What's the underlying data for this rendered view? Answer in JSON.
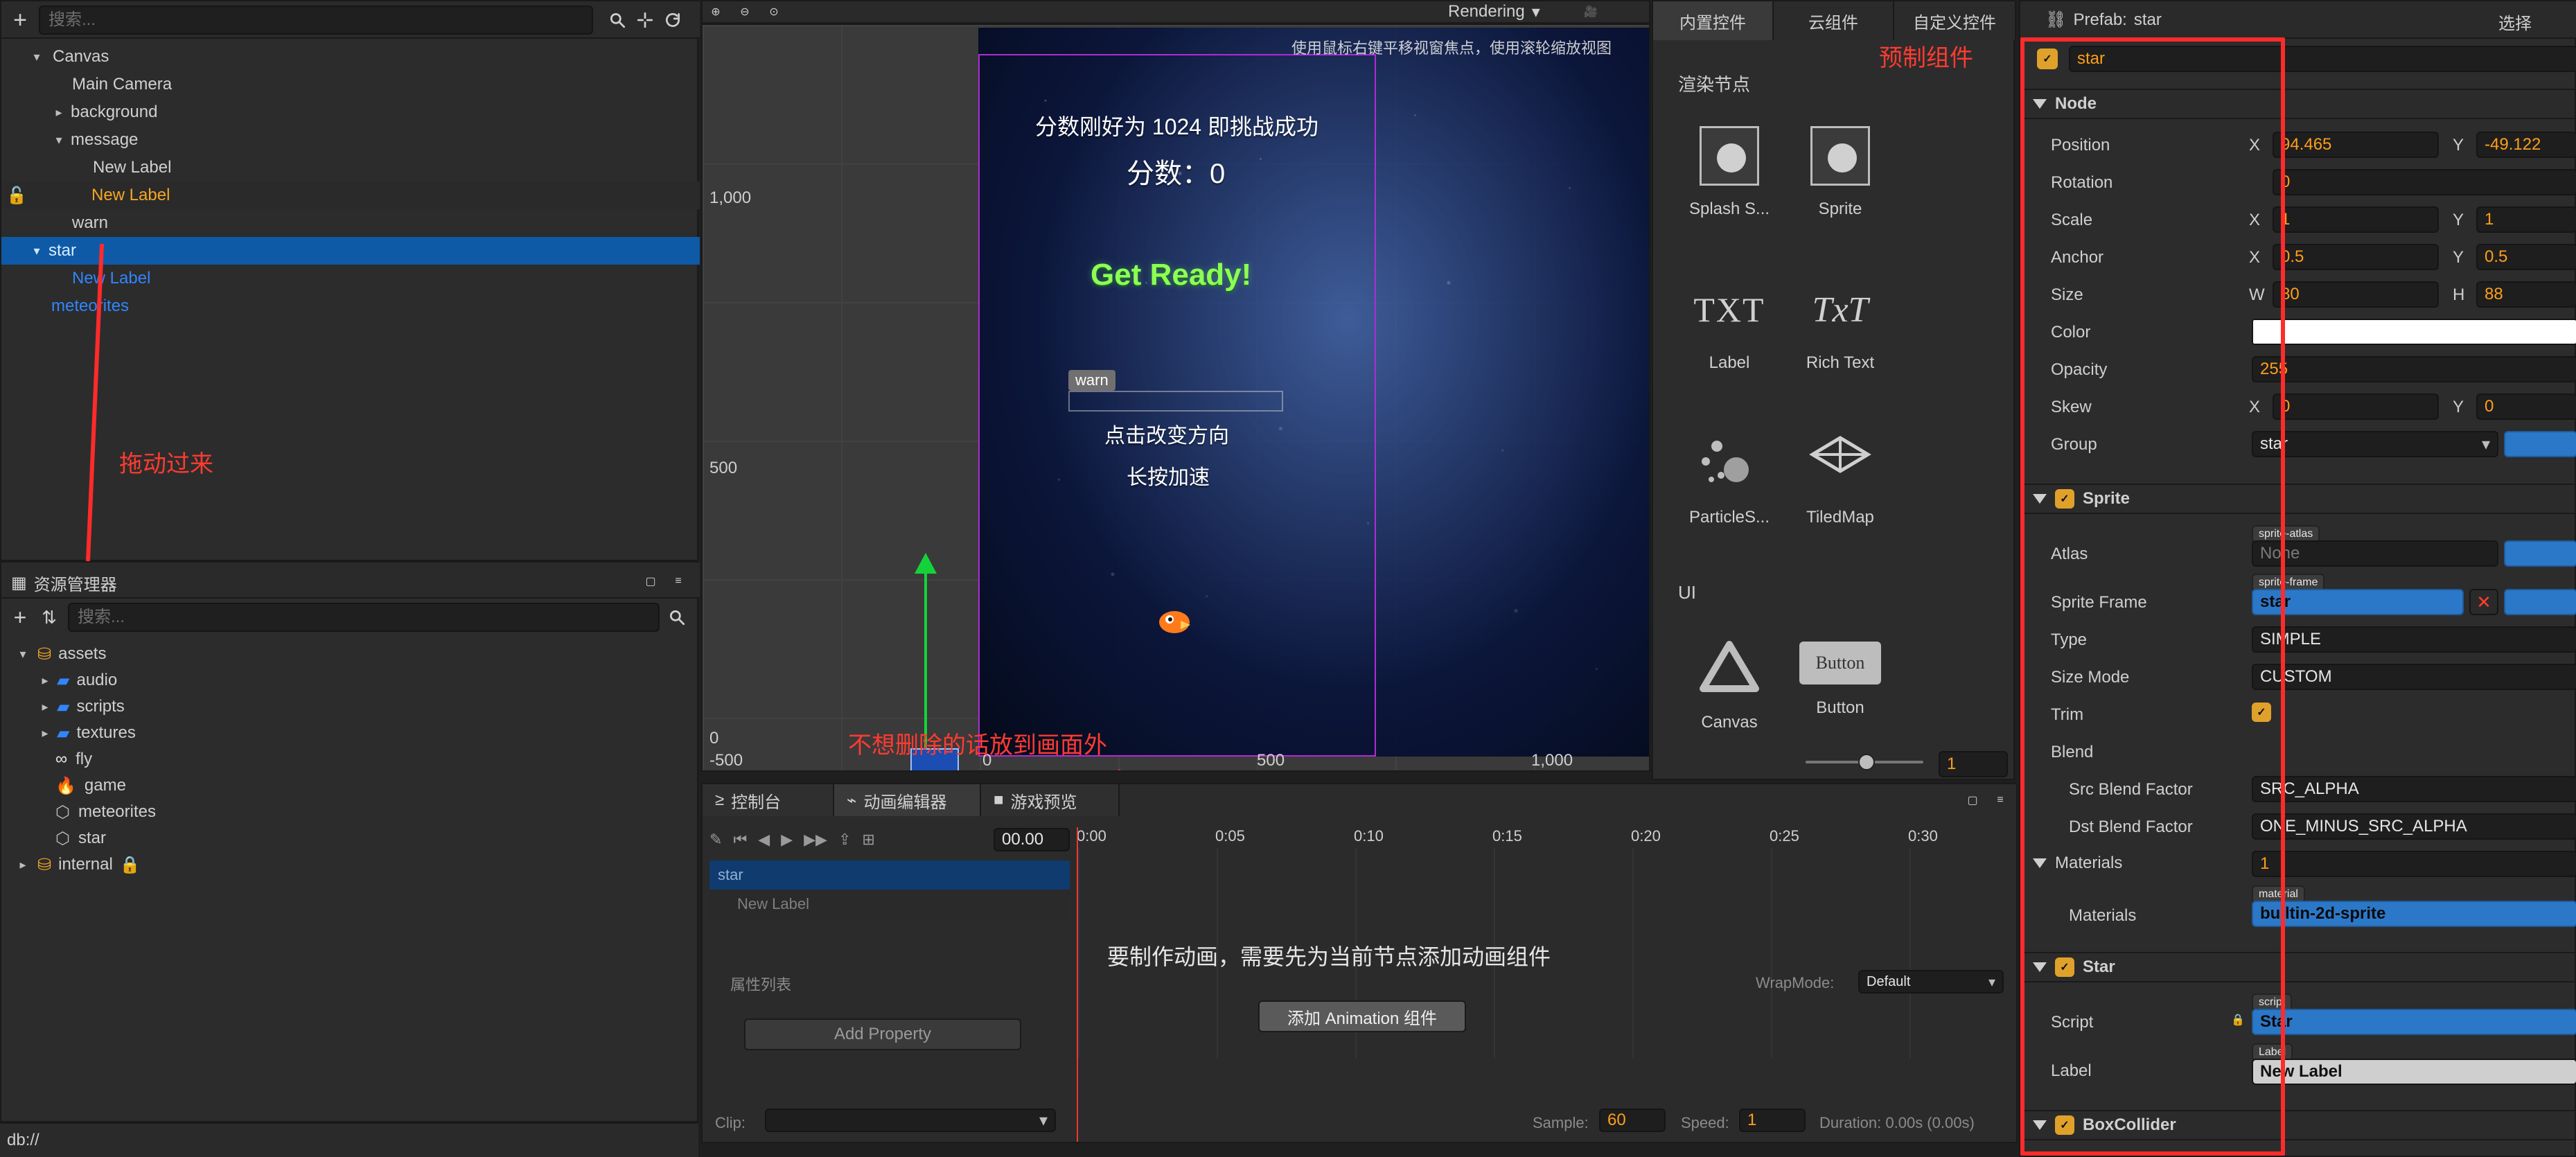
{
  "top_left": {
    "search_placeholder": "搜索...",
    "icons": [
      "add-icon",
      "search-icon",
      "crosshair-icon",
      "refresh-icon"
    ]
  },
  "hierarchy": {
    "items": [
      {
        "label": "Canvas",
        "level": 0,
        "expanded": true,
        "color": "default"
      },
      {
        "label": "Main Camera",
        "level": 1,
        "expanded": false,
        "color": "default"
      },
      {
        "label": "background",
        "level": 1,
        "expanded": false,
        "color": "default",
        "has_caret": "right"
      },
      {
        "label": "message",
        "level": 1,
        "expanded": true,
        "color": "default",
        "has_caret": "down"
      },
      {
        "label": "New Label",
        "level": 2,
        "expanded": false,
        "color": "default"
      },
      {
        "label": "New Label",
        "level": 2,
        "expanded": false,
        "color": "orange",
        "lock": true
      },
      {
        "label": "warn",
        "level": 1,
        "expanded": false,
        "color": "default"
      },
      {
        "label": "star",
        "level": 0,
        "expanded": true,
        "color": "blue",
        "selected": true
      },
      {
        "label": "New Label",
        "level": 1,
        "expanded": false,
        "color": "blue"
      },
      {
        "label": "meteorites",
        "level": 0,
        "expanded": false,
        "color": "blue"
      }
    ]
  },
  "asset_manager": {
    "title": "资源管理器",
    "search_placeholder": "搜索...",
    "items": [
      {
        "label": "assets",
        "level": 0,
        "type": "folder",
        "expanded": true
      },
      {
        "label": "audio",
        "level": 1,
        "type": "folder",
        "expanded": false
      },
      {
        "label": "scripts",
        "level": 1,
        "type": "folder",
        "expanded": false
      },
      {
        "label": "textures",
        "level": 1,
        "type": "folder",
        "expanded": false
      },
      {
        "label": "fly",
        "level": 1,
        "type": "anim"
      },
      {
        "label": "game",
        "level": 1,
        "type": "scene"
      },
      {
        "label": "meteorites",
        "level": 1,
        "type": "prefab"
      },
      {
        "label": "star",
        "level": 1,
        "type": "prefab"
      },
      {
        "label": "internal",
        "level": 0,
        "type": "folder",
        "expanded": false,
        "lock": true
      }
    ]
  },
  "scene": {
    "hint": "使用鼠标右键平移视窗焦点，使用滚轮缩放视图",
    "rendering_label": "Rendering",
    "tick_labels": {
      "y1000": "1,000",
      "y500": "500",
      "y0": "0",
      "x_500": "-500",
      "x0": "0",
      "x500": "500",
      "x1000": "1,000"
    },
    "game_text": {
      "line1": "分数刚好为 1024 即挑战成功",
      "line2": "分数：0",
      "ready": "Get Ready!",
      "warn": "warn",
      "hint1": "点击改变方向",
      "hint2": "长按加速"
    },
    "annotations": {
      "drag": "拖动过来",
      "offscreen": "不想删除的话放到画面外",
      "prefab": "预制组件"
    }
  },
  "right_palette": {
    "tabs": [
      "内置控件",
      "云组件",
      "自定义控件"
    ],
    "active_tab": 0,
    "section_render": "渲染节点",
    "render_items": [
      {
        "label": "Splash S...",
        "icon": "splash-icon"
      },
      {
        "label": "Sprite",
        "icon": "sprite-icon"
      },
      {
        "label": "Label",
        "icon": "label-icon",
        "glyph": "TXT"
      },
      {
        "label": "Rich Text",
        "icon": "richtext-icon",
        "glyph": "TxT"
      },
      {
        "label": "ParticleS...",
        "icon": "particles-icon"
      },
      {
        "label": "TiledMap",
        "icon": "tiledmap-icon"
      }
    ],
    "section_ui": "UI",
    "ui_items": [
      {
        "label": "Canvas",
        "icon": "canvas-icon"
      },
      {
        "label": "Button",
        "icon": "button-icon",
        "glyph": "Button"
      }
    ],
    "zoom_value": "1"
  },
  "timeline": {
    "tabs": [
      "控制台",
      "动画编辑器",
      "游戏预览"
    ],
    "active_tab": 1,
    "ruler": [
      "0:00",
      "0:05",
      "0:10",
      "0:15",
      "0:20",
      "0:25",
      "0:30"
    ],
    "tracks": [
      "star",
      "New Label"
    ],
    "time_value": "00.00",
    "message": "要制作动画，需要先为当前节点添加动画组件",
    "property_list_label": "属性列表",
    "wrap_mode_label": "WrapMode:",
    "wrap_mode_value": "Default",
    "add_property": "Add Property",
    "add_animation": "添加 Animation 组件",
    "clip_label": "Clip:",
    "sample_label": "Sample:",
    "sample_value": "60",
    "speed_label": "Speed:",
    "speed_value": "1",
    "duration_label": "Duration: 0.00s (0.00s)"
  },
  "status_bar": {
    "text": "db://"
  },
  "inspector": {
    "prefab_label": "Prefab:",
    "prefab_name": "star",
    "select_label": "选择",
    "node_name": "star",
    "node_section": "Node",
    "props": {
      "position": {
        "label": "Position",
        "x": "94.465",
        "y": "-49.122"
      },
      "rotation": {
        "label": "Rotation",
        "value": "0"
      },
      "scale": {
        "label": "Scale",
        "x": "1",
        "y": "1"
      },
      "anchor": {
        "label": "Anchor",
        "x": "0.5",
        "y": "0.5"
      },
      "size": {
        "label": "Size",
        "w": "80",
        "h": "88"
      },
      "color": {
        "label": "Color"
      },
      "opacity": {
        "label": "Opacity",
        "value": "255"
      },
      "skew": {
        "label": "Skew",
        "x": "0",
        "y": "0"
      },
      "group": {
        "label": "Group",
        "value": "star"
      }
    },
    "sprite_section": "Sprite",
    "sprite": {
      "atlas_label": "Atlas",
      "atlas_tag": "sprite-atlas",
      "atlas_value": "None",
      "sprite_frame_label": "Sprite Frame",
      "sprite_frame_tag": "sprite-frame",
      "sprite_frame_value": "star",
      "type_label": "Type",
      "type_value": "SIMPLE",
      "size_mode_label": "Size Mode",
      "size_mode_value": "CUSTOM",
      "trim_label": "Trim",
      "blend_label": "Blend",
      "src_label": "Src Blend Factor",
      "src_value": "SRC_ALPHA",
      "dst_label": "Dst Blend Factor",
      "dst_value": "ONE_MINUS_SRC_ALPHA",
      "materials_label": "Materials",
      "materials_count": "1",
      "materials_tag": "material",
      "materials_value": "builtin-2d-sprite"
    },
    "star_section": "Star",
    "star": {
      "script_label": "Script",
      "script_tag": "script",
      "script_value": "Star",
      "label_label": "Label",
      "label_tag": "Label",
      "label_value": "New Label"
    },
    "boxcollider_section": "BoxCollider"
  },
  "colors": {
    "selection_blue": "#0f5aa6",
    "accent_orange": "#f5a623",
    "annotation_red": "#ff3b30"
  }
}
